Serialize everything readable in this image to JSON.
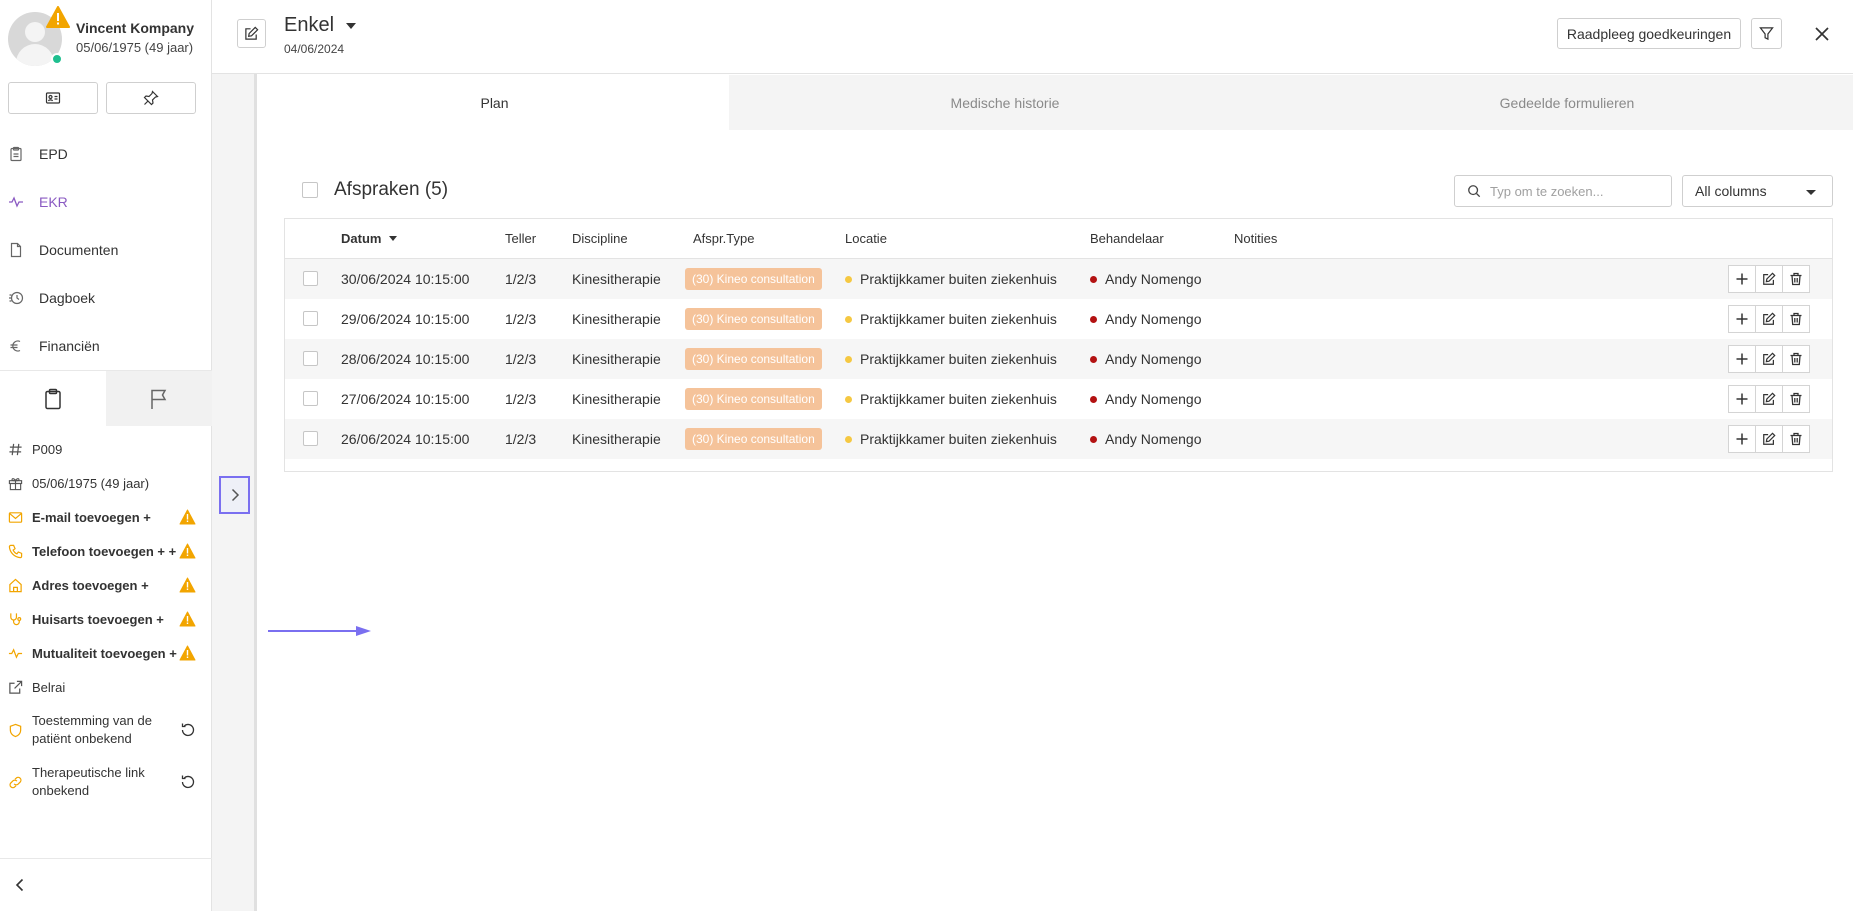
{
  "patient": {
    "name": "Vincent Kompany",
    "dob": "05/06/1975 (49 jaar)"
  },
  "nav": {
    "items": [
      {
        "label": "EPD",
        "icon": "clipboard-icon"
      },
      {
        "label": "EKR",
        "icon": "activity-icon"
      },
      {
        "label": "Documenten",
        "icon": "document-icon"
      },
      {
        "label": "Dagboek",
        "icon": "history-icon"
      },
      {
        "label": "Financiën",
        "icon": "euro-icon"
      }
    ],
    "active": "EKR"
  },
  "info": {
    "id": "P009",
    "birthday": "05/06/1975 (49 jaar)",
    "email": "E-mail toevoegen +",
    "phone": "Telefoon toevoegen + +",
    "address": "Adres toevoegen +",
    "gp": "Huisarts toevoegen +",
    "mutuality": "Mutualiteit toevoegen +",
    "belrai": "Belrai",
    "consent_1": "Toestemming van de",
    "consent_2": "patiënt onbekend",
    "therapeutic_1": "Therapeutische link",
    "therapeutic_2": "onbekend"
  },
  "header": {
    "title": "Enkel",
    "date": "04/06/2024",
    "approvals_label": "Raadpleeg goedkeuringen"
  },
  "tabs": [
    {
      "label": "Plan",
      "active": true
    },
    {
      "label": "Medische historie",
      "active": false
    },
    {
      "label": "Gedeelde formulieren",
      "active": false
    }
  ],
  "table": {
    "title": "Afspraken (5)",
    "search_placeholder": "Typ om te zoeken...",
    "column_filter": "All columns",
    "columns": [
      "Datum",
      "Teller",
      "Discipline",
      "Afspr.Type",
      "Locatie",
      "Behandelaar",
      "Notities"
    ],
    "sorted_column": "Datum",
    "rows": [
      {
        "datum": "30/06/2024 10:15:00",
        "teller": "1/2/3",
        "discipline": "Kinesitherapie",
        "type": "(30) Kineo consultation",
        "locatie": "Praktijkkamer buiten ziekenhuis",
        "behandelaar": "Andy Nomengo",
        "notities": ""
      },
      {
        "datum": "29/06/2024 10:15:00",
        "teller": "1/2/3",
        "discipline": "Kinesitherapie",
        "type": "(30) Kineo consultation",
        "locatie": "Praktijkkamer buiten ziekenhuis",
        "behandelaar": "Andy Nomengo",
        "notities": ""
      },
      {
        "datum": "28/06/2024 10:15:00",
        "teller": "1/2/3",
        "discipline": "Kinesitherapie",
        "type": "(30) Kineo consultation",
        "locatie": "Praktijkkamer buiten ziekenhuis",
        "behandelaar": "Andy Nomengo",
        "notities": ""
      },
      {
        "datum": "27/06/2024 10:15:00",
        "teller": "1/2/3",
        "discipline": "Kinesitherapie",
        "type": "(30) Kineo consultation",
        "locatie": "Praktijkkamer buiten ziekenhuis",
        "behandelaar": "Andy Nomengo",
        "notities": ""
      },
      {
        "datum": "26/06/2024 10:15:00",
        "teller": "1/2/3",
        "discipline": "Kinesitherapie",
        "type": "(30) Kineo consultation",
        "locatie": "Praktijkkamer buiten ziekenhuis",
        "behandelaar": "Andy Nomengo",
        "notities": ""
      }
    ]
  },
  "colors": {
    "accent": "#8a5ac2",
    "warning": "#f2a500",
    "badge": "#f5c39a",
    "location_dot": "#f5c842",
    "practitioner_dot": "#b31212",
    "online": "#1fbf8f",
    "highlight_border": "#7a6ff0"
  }
}
